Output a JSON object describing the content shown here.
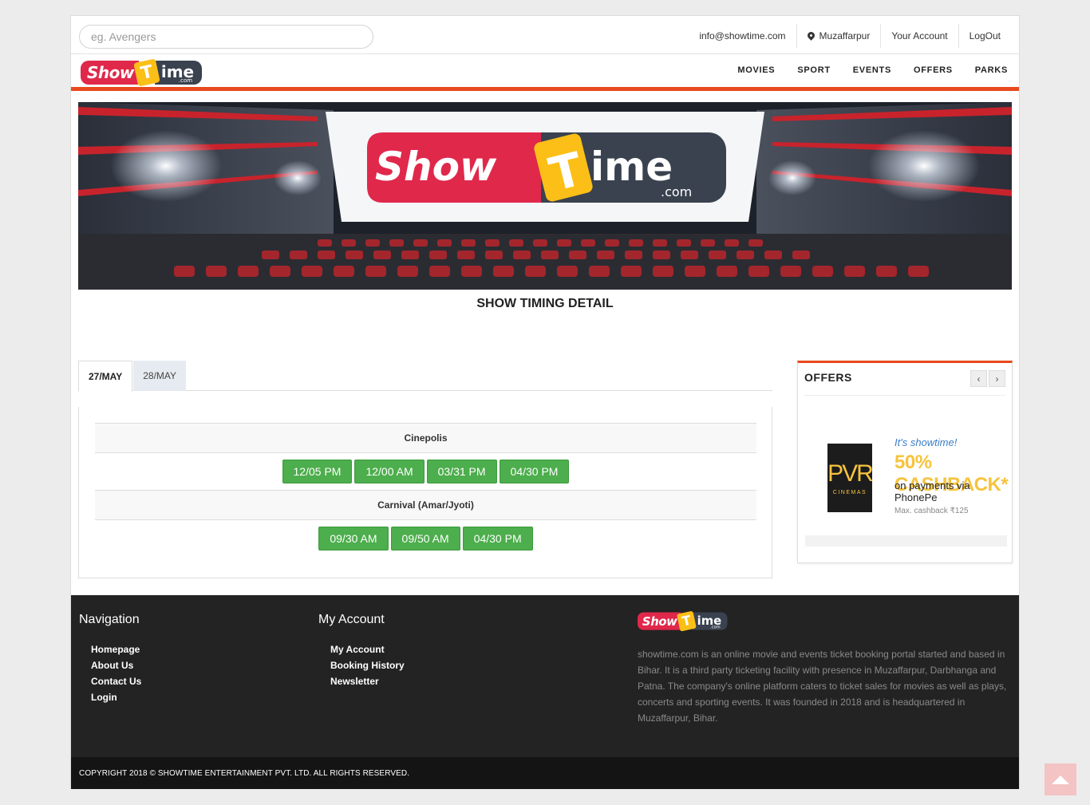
{
  "search": {
    "placeholder": "eg. Avengers"
  },
  "toplinks": {
    "email": "info@showtime.com",
    "city": "Muzaffarpur",
    "account": "Your Account",
    "logout": "LogOut"
  },
  "logo": {
    "part1": "Show",
    "part2": "T",
    "part3": "ime",
    "domain": ".com"
  },
  "nav": {
    "items": [
      "MOVIES",
      "SPORT",
      "EVENTS",
      "OFFERS",
      "PARKS"
    ]
  },
  "page": {
    "title": "SHOW TIMING DETAIL"
  },
  "tabs": [
    {
      "label": "27/MAY",
      "active": true
    },
    {
      "label": "28/MAY",
      "active": false
    }
  ],
  "cinemas": [
    {
      "name": "Cinepolis",
      "times": [
        "12/05 PM",
        "12/00 AM",
        "03/31 PM",
        "04/30 PM"
      ]
    },
    {
      "name": "Carnival (Amar/Jyoti)",
      "times": [
        "09/30 AM",
        "09/50 AM",
        "04/30 PM"
      ]
    }
  ],
  "offers": {
    "title": "OFFERS",
    "prev_icon": "chevron-left-icon",
    "next_icon": "chevron-right-icon",
    "card": {
      "brand": "PVR",
      "brand_sub": "CINEMAS",
      "line1": "It's showtime!",
      "line2": "50% CASHBACK*",
      "line3": "on payments via PhonePe",
      "line4": "Max. cashback ₹125"
    }
  },
  "footer": {
    "nav_title": "Navigation",
    "nav_links": [
      "Homepage",
      "About Us",
      "Contact Us",
      "Login"
    ],
    "account_title": "My Account",
    "account_links": [
      "My Account",
      "Booking History",
      "Newsletter"
    ],
    "about": "showtime.com is an online movie and events ticket booking portal started and based in Bihar. It is a third party ticketing facility with presence in Muzaffarpur, Darbhanga and Patna. The company's online platform caters to ticket sales for movies as well as plays, concerts and sporting events. It was founded in 2018 and is headquartered in Muzaffarpur, Bihar.",
    "copyright": "COPYRIGHT 2018 © SHOWTIME ENTERTAINMENT PVT. LTD. ALL RIGHTS RESERVED."
  },
  "colors": {
    "accent": "#e8491d",
    "slot_green": "#4cae4c",
    "footer_bg": "#232323"
  }
}
